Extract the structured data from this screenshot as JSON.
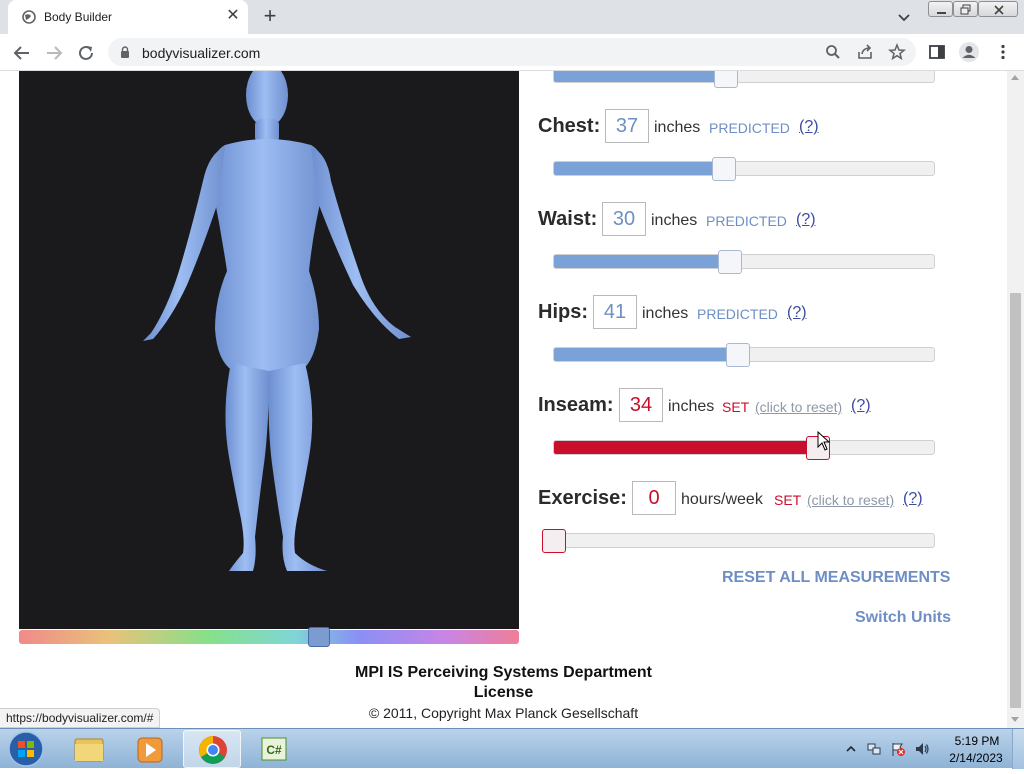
{
  "browser": {
    "tab_title": "Body Builder",
    "url": "bodyvisualizer.com",
    "status_url": "https://bodyvisualizer.com/#"
  },
  "measurements": [
    {
      "label": "Chest:",
      "value": "37",
      "unit": "inches",
      "status": "PREDICTED",
      "reset": "",
      "help": "(?)",
      "slider_fraction": 0.45,
      "set": false
    },
    {
      "label": "Waist:",
      "value": "30",
      "unit": "inches",
      "status": "PREDICTED",
      "reset": "",
      "help": "(?)",
      "slider_fraction": 0.47,
      "set": false
    },
    {
      "label": "Hips:",
      "value": "41",
      "unit": "inches",
      "status": "PREDICTED",
      "reset": "",
      "help": "(?)",
      "slider_fraction": 0.48,
      "set": false
    },
    {
      "label": "Inseam:",
      "value": "34",
      "unit": "inches",
      "status": "SET",
      "reset": "(click to reset)",
      "help": "(?)",
      "slider_fraction": 0.69,
      "set": true
    },
    {
      "label": "Exercise:",
      "value": "0",
      "unit": "hours/week",
      "status": "SET",
      "reset": "(click to reset)",
      "help": "(?)",
      "slider_fraction": 0.0,
      "set": true
    }
  ],
  "top_slider_fraction": 0.44,
  "body_color_fraction": 0.6,
  "actions": {
    "reset_all": "RESET ALL MEASUREMENTS",
    "switch_units": "Switch Units"
  },
  "footer": {
    "dept": "MPI IS Perceiving Systems Department",
    "license": "License",
    "copyright": "© 2011, Copyright Max Planck Gesellschaft"
  },
  "taskbar": {
    "time": "5:19 PM",
    "date": "2/14/2023",
    "apps": [
      "file-explorer",
      "media-player",
      "chrome",
      "visual-studio-csharp"
    ]
  },
  "colors": {
    "accent_blue": "#6f8fc4",
    "set_red": "#c8102e",
    "body_blue": "#8fb2ee",
    "canvas_bg": "#1a1a1c"
  }
}
